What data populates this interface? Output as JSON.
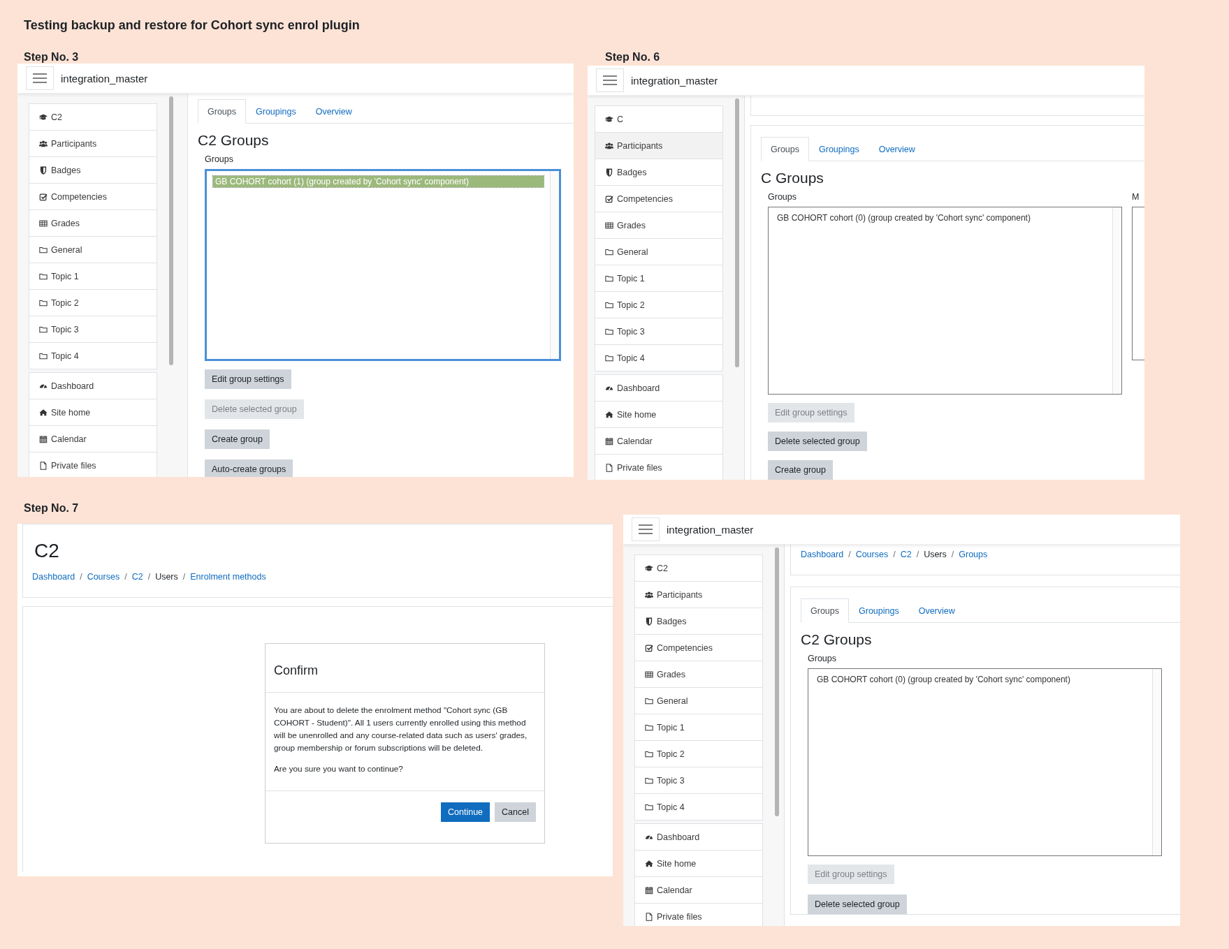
{
  "title": "Testing backup and restore for Cohort sync enrol plugin",
  "steps": [
    {
      "label": "Step No. 3",
      "kind": "groups",
      "site_name": "integration_master",
      "nav_groups": [
        {
          "items": [
            {
              "label": "C2",
              "kind": "course",
              "highlighted": false
            },
            {
              "label": "Participants",
              "kind": "participants",
              "highlighted": false
            },
            {
              "label": "Badges",
              "kind": "badges",
              "highlighted": false
            },
            {
              "label": "Competencies",
              "kind": "competencies",
              "highlighted": false
            },
            {
              "label": "Grades",
              "kind": "grades",
              "highlighted": false
            },
            {
              "label": "General",
              "kind": "section",
              "highlighted": false
            },
            {
              "label": "Topic 1",
              "kind": "section",
              "highlighted": false
            },
            {
              "label": "Topic 2",
              "kind": "section",
              "highlighted": false
            },
            {
              "label": "Topic 3",
              "kind": "section",
              "highlighted": false
            },
            {
              "label": "Topic 4",
              "kind": "section",
              "highlighted": false
            }
          ]
        },
        {
          "items": [
            {
              "label": "Dashboard",
              "kind": "dashboard",
              "highlighted": false
            },
            {
              "label": "Site home",
              "kind": "home",
              "highlighted": false
            },
            {
              "label": "Calendar",
              "kind": "calendar",
              "highlighted": false
            },
            {
              "label": "Private files",
              "kind": "files",
              "highlighted": false
            }
          ]
        }
      ],
      "tabs": [
        {
          "label": "Groups",
          "selected": true
        },
        {
          "label": "Groupings",
          "selected": false
        },
        {
          "label": "Overview",
          "selected": false
        }
      ],
      "heading": "C2 Groups",
      "list_label": "Groups",
      "listbox_focused": true,
      "groups": [
        {
          "label": "GB COHORT cohort (1) (group created by 'Cohort sync' component)",
          "selected": true
        }
      ],
      "buttons": [
        {
          "label": "Edit group settings",
          "disabled": false
        },
        {
          "label": "Delete selected group",
          "disabled": true
        },
        {
          "label": "Create group",
          "disabled": false
        },
        {
          "label": "Auto-create groups",
          "disabled": false
        }
      ]
    },
    {
      "label": "Step No. 6",
      "kind": "groups",
      "site_name": "integration_master",
      "header_card_scrolled": true,
      "nav_groups": [
        {
          "items": [
            {
              "label": "C",
              "kind": "course",
              "highlighted": false
            },
            {
              "label": "Participants",
              "kind": "participants",
              "highlighted": true
            },
            {
              "label": "Badges",
              "kind": "badges",
              "highlighted": false
            },
            {
              "label": "Competencies",
              "kind": "competencies",
              "highlighted": false
            },
            {
              "label": "Grades",
              "kind": "grades",
              "highlighted": false
            },
            {
              "label": "General",
              "kind": "section",
              "highlighted": false
            },
            {
              "label": "Topic 1",
              "kind": "section",
              "highlighted": false
            },
            {
              "label": "Topic 2",
              "kind": "section",
              "highlighted": false
            },
            {
              "label": "Topic 3",
              "kind": "section",
              "highlighted": false
            },
            {
              "label": "Topic 4",
              "kind": "section",
              "highlighted": false
            }
          ]
        },
        {
          "items": [
            {
              "label": "Dashboard",
              "kind": "dashboard",
              "highlighted": false
            },
            {
              "label": "Site home",
              "kind": "home",
              "highlighted": false
            },
            {
              "label": "Calendar",
              "kind": "calendar",
              "highlighted": false
            },
            {
              "label": "Private files",
              "kind": "files",
              "highlighted": false
            }
          ]
        }
      ],
      "tabs": [
        {
          "label": "Groups",
          "selected": true
        },
        {
          "label": "Groupings",
          "selected": false
        },
        {
          "label": "Overview",
          "selected": false
        }
      ],
      "heading": "C Groups",
      "list_label": "Groups",
      "members_label": "M",
      "listbox_focused": false,
      "groups": [
        {
          "label": "GB COHORT cohort (0) (group created by 'Cohort sync' component)",
          "selected": false
        }
      ],
      "buttons": [
        {
          "label": "Edit group settings",
          "disabled": true
        },
        {
          "label": "Delete selected group",
          "disabled": false
        },
        {
          "label": "Create group",
          "disabled": false
        }
      ]
    },
    {
      "label": "Step No. 7",
      "kind": "confirm",
      "page_heading": "C2",
      "breadcrumb": [
        {
          "label": "Dashboard",
          "kind": "link"
        },
        {
          "label": "/",
          "kind": "separator"
        },
        {
          "label": "Courses",
          "kind": "link"
        },
        {
          "label": "/",
          "kind": "separator"
        },
        {
          "label": "C2",
          "kind": "link"
        },
        {
          "label": "/",
          "kind": "separator"
        },
        {
          "label": "Users",
          "kind": "text"
        },
        {
          "label": "/",
          "kind": "separator"
        },
        {
          "label": "Enrolment methods",
          "kind": "link"
        }
      ],
      "dialog": {
        "title": "Confirm",
        "message": "You are about to delete the enrolment method \"Cohort sync (GB COHORT - Student)\". All 1 users currently enrolled using this method will be unenrolled and any course-related data such as users' grades, group membership or forum subscriptions will be deleted.",
        "question": "Are you sure you want to continue?",
        "buttons": [
          {
            "label": "Continue",
            "kind": "primary"
          },
          {
            "label": "Cancel",
            "kind": "secondary"
          }
        ]
      }
    },
    {
      "kind": "groups",
      "site_name": "integration_master",
      "breadcrumb": [
        {
          "label": "Dashboard",
          "kind": "link"
        },
        {
          "label": "/",
          "kind": "separator"
        },
        {
          "label": "Courses",
          "kind": "link"
        },
        {
          "label": "/",
          "kind": "separator"
        },
        {
          "label": "C2",
          "kind": "link"
        },
        {
          "label": "/",
          "kind": "separator"
        },
        {
          "label": "Users",
          "kind": "text"
        },
        {
          "label": "/",
          "kind": "separator"
        },
        {
          "label": "Groups",
          "kind": "link"
        }
      ],
      "nav_groups": [
        {
          "items": [
            {
              "label": "C2",
              "kind": "course",
              "highlighted": false
            },
            {
              "label": "Participants",
              "kind": "participants",
              "highlighted": false
            },
            {
              "label": "Badges",
              "kind": "badges",
              "highlighted": false
            },
            {
              "label": "Competencies",
              "kind": "competencies",
              "highlighted": false
            },
            {
              "label": "Grades",
              "kind": "grades",
              "highlighted": false
            },
            {
              "label": "General",
              "kind": "section",
              "highlighted": false
            },
            {
              "label": "Topic 1",
              "kind": "section",
              "highlighted": false
            },
            {
              "label": "Topic 2",
              "kind": "section",
              "highlighted": false
            },
            {
              "label": "Topic 3",
              "kind": "section",
              "highlighted": false
            },
            {
              "label": "Topic 4",
              "kind": "section",
              "highlighted": false
            }
          ]
        },
        {
          "items": [
            {
              "label": "Dashboard",
              "kind": "dashboard",
              "highlighted": false
            },
            {
              "label": "Site home",
              "kind": "home",
              "highlighted": false
            },
            {
              "label": "Calendar",
              "kind": "calendar",
              "highlighted": false
            },
            {
              "label": "Private files",
              "kind": "files",
              "highlighted": false
            }
          ]
        }
      ],
      "tabs": [
        {
          "label": "Groups",
          "selected": true
        },
        {
          "label": "Groupings",
          "selected": false
        },
        {
          "label": "Overview",
          "selected": false
        }
      ],
      "heading": "C2 Groups",
      "list_label": "Groups",
      "listbox_focused": false,
      "groups": [
        {
          "label": "GB COHORT cohort (0) (group created by 'Cohort sync' component)",
          "selected": false
        }
      ],
      "buttons": [
        {
          "label": "Edit group settings",
          "disabled": true
        },
        {
          "label": "Delete selected group",
          "disabled": false
        }
      ]
    }
  ]
}
